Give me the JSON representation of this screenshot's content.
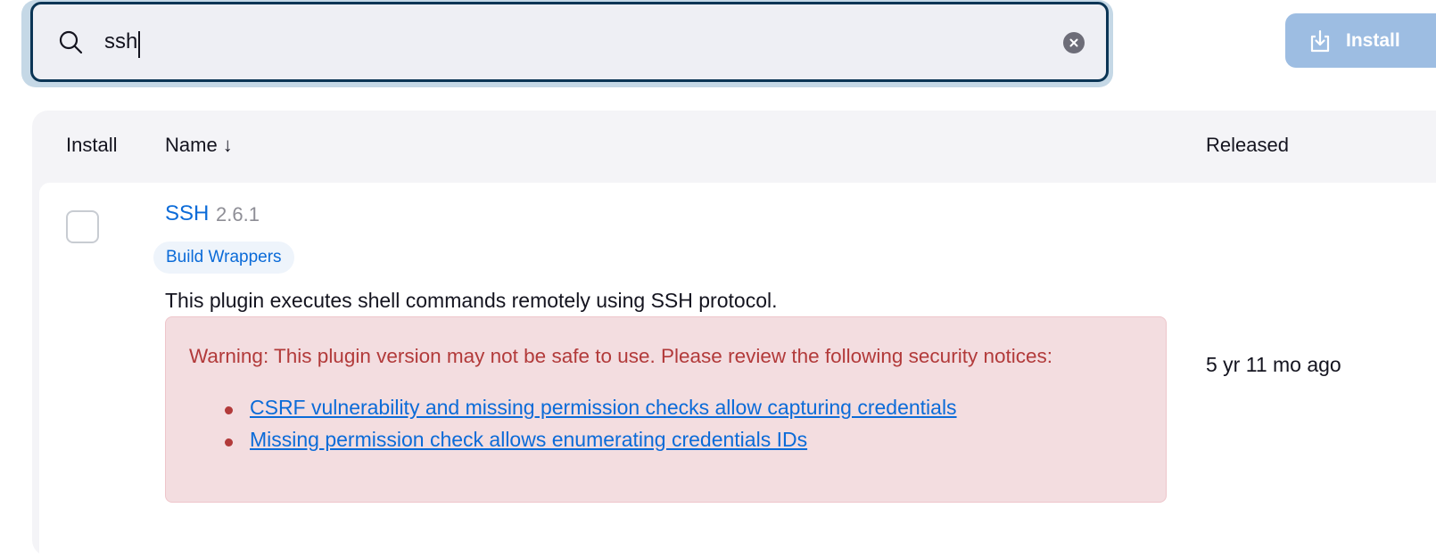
{
  "search": {
    "value": "ssh"
  },
  "toolbar": {
    "install_label": "Install"
  },
  "table": {
    "columns": {
      "install": "Install",
      "name": "Name ↓",
      "released": "Released"
    },
    "rows": [
      {
        "name": "SSH",
        "version": "2.6.1",
        "tag": "Build Wrappers",
        "description": "This plugin executes shell commands remotely using SSH protocol.",
        "warning": "Warning: This plugin version may not be safe to use. Please review the following security notices:",
        "notices": [
          "CSRF vulnerability and missing permission checks allow capturing credentials",
          "Missing permission check allows enumerating credentials IDs"
        ],
        "released": "5 yr 11 mo ago"
      }
    ]
  },
  "icons": {
    "search": "search-icon",
    "clear": "clear-icon",
    "install": "download-icon"
  },
  "colors": {
    "accent": "#0b6bd8",
    "warning_text": "#b23a3a",
    "warning_bg": "#f3dde0",
    "install_button": "#9dbde2"
  }
}
